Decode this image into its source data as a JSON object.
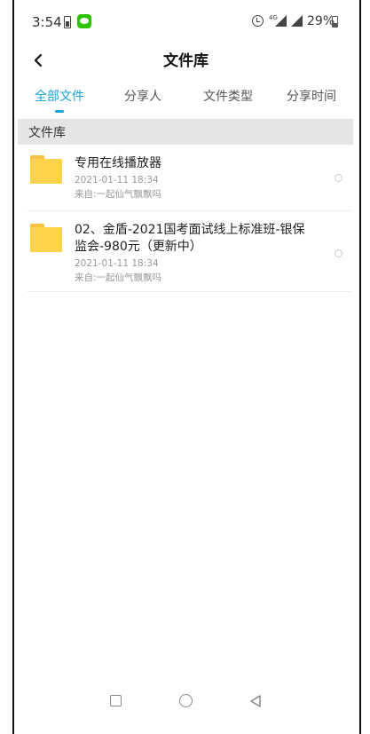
{
  "status_bar": {
    "time": "3:54",
    "network": "4G",
    "battery_percent": "29%",
    "icons": [
      "battery-saver-icon",
      "wechat-icon",
      "alarm-icon",
      "signal-icon",
      "battery-icon"
    ]
  },
  "header": {
    "title": "文件库",
    "back_icon": "chevron-left-icon"
  },
  "tabs": [
    {
      "label": "全部文件",
      "active": true
    },
    {
      "label": "分享人",
      "active": false
    },
    {
      "label": "文件类型",
      "active": false
    },
    {
      "label": "分享时间",
      "active": false
    }
  ],
  "colors": {
    "accent": "#1aa3d4",
    "folder": "#fdd34a",
    "section_bg": "#e5e5e5",
    "meta_text": "#999999"
  },
  "section": {
    "title": "文件库"
  },
  "files": [
    {
      "name": "专用在线播放器",
      "date": "2021-01-11  18:34",
      "source": "来自:一起仙气飘飘吗",
      "icon": "folder-icon"
    },
    {
      "name": "02、金盾-2021国考面试线上标准班-银保监会-980元（更新中）",
      "date": "2021-01-11  18:34",
      "source": "来自:一起仙气飘飘吗",
      "icon": "folder-icon"
    }
  ],
  "nav_bar": {
    "icons": [
      "recents-icon",
      "home-icon",
      "back-icon"
    ]
  }
}
